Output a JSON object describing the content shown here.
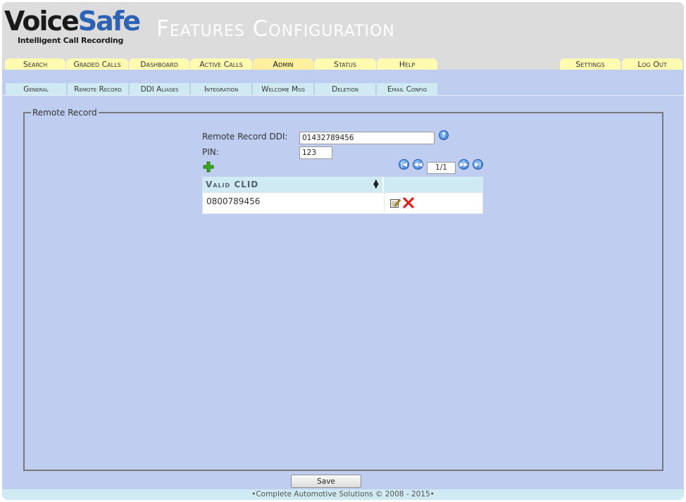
{
  "header": {
    "logo_part1": "Voice",
    "logo_part2": "Safe",
    "logo_subtitle": "Intelligent Call Recording",
    "page_title": "Features Configuration"
  },
  "colors": {
    "logo_dark": "#1a1a1a",
    "logo_blue": "#2d62b4",
    "tab_yellow": "#fffbb0",
    "background_blue": "#bfcdf0",
    "subtab_cyan": "#cfeaf2",
    "delete_red": "#e0201a",
    "add_green": "#3aa51f"
  },
  "main_nav": {
    "tabs": [
      {
        "label": "Search"
      },
      {
        "label": "Graded Calls"
      },
      {
        "label": "Dashboard"
      },
      {
        "label": "Active Calls"
      },
      {
        "label": "Admin",
        "active": true
      },
      {
        "label": "Status"
      },
      {
        "label": "Help"
      }
    ],
    "right_tabs": [
      {
        "label": "Settings"
      },
      {
        "label": "Log Out"
      }
    ]
  },
  "sub_nav": {
    "tabs": [
      {
        "label": "General"
      },
      {
        "label": "Remote Record",
        "active": true
      },
      {
        "label": "DDI Aliases"
      },
      {
        "label": "Integration"
      },
      {
        "label": "Welcome Msg"
      },
      {
        "label": "Deletion"
      },
      {
        "label": "Email Config"
      }
    ]
  },
  "form": {
    "legend": "Remote Record",
    "ddi_label": "Remote Record DDI:",
    "ddi_value": "01432789456",
    "pin_label": "PIN:",
    "pin_value": "123"
  },
  "pager": {
    "page_display": "1/1",
    "first_icon": "first-page-icon",
    "prev_icon": "previous-page-icon",
    "next_icon": "next-page-icon",
    "last_icon": "last-page-icon"
  },
  "grid": {
    "columns": [
      "Valid CLID",
      ""
    ],
    "rows": [
      {
        "clid": "0800789456"
      }
    ]
  },
  "actions": {
    "save_label": "Save"
  },
  "footer": {
    "text": "•Complete Automotive Solutions © 2008 - 2015•"
  }
}
